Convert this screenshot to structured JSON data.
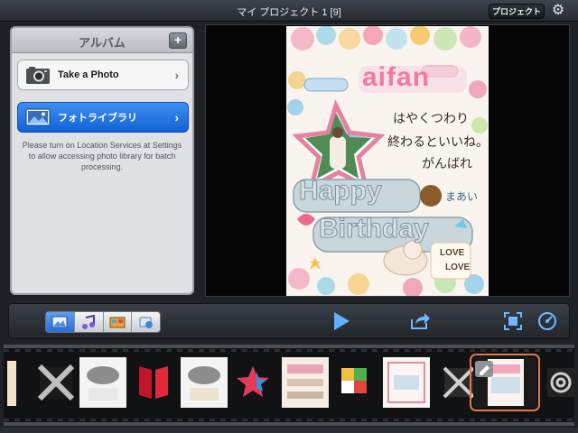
{
  "topbar": {
    "title": "マイ プロジェクト 1  [9]",
    "project_button": "プロジェクト",
    "settings_icon": "gear-icon"
  },
  "album": {
    "title": "アルバム",
    "add_button": "+",
    "items": [
      {
        "label": "Take a Photo",
        "icon": "camera-icon"
      },
      {
        "label": "フォトライブラリ",
        "icon": "photo-library-icon"
      }
    ],
    "note": "Please turn on Location Services at Settings to allow accessing photo library for batch processing."
  },
  "preview": {
    "card_text_1": "aifan",
    "card_text_2": "はやくつわり",
    "card_text_3": "終わるといいね。",
    "card_text_4": "がんばれ",
    "card_text_5": "Happy",
    "card_text_6": "Birthday",
    "card_text_7": "まあい",
    "card_text_8": "LOVE",
    "card_text_9": "LOVE"
  },
  "toolbar": {
    "segments": [
      {
        "icon": "photos-icon",
        "active": true
      },
      {
        "icon": "music-icon",
        "active": false
      },
      {
        "icon": "themes-icon",
        "active": false
      },
      {
        "icon": "export-icon",
        "active": false
      }
    ],
    "play_icon": "play-icon",
    "share_icon": "share-icon",
    "fit_icon": "fit-screen-icon",
    "speed_icon": "speed-icon"
  },
  "colors": {
    "accent": "#1f6fe0",
    "selection": "#e07a4a",
    "toolbar_icon": "#6fb8ff"
  }
}
